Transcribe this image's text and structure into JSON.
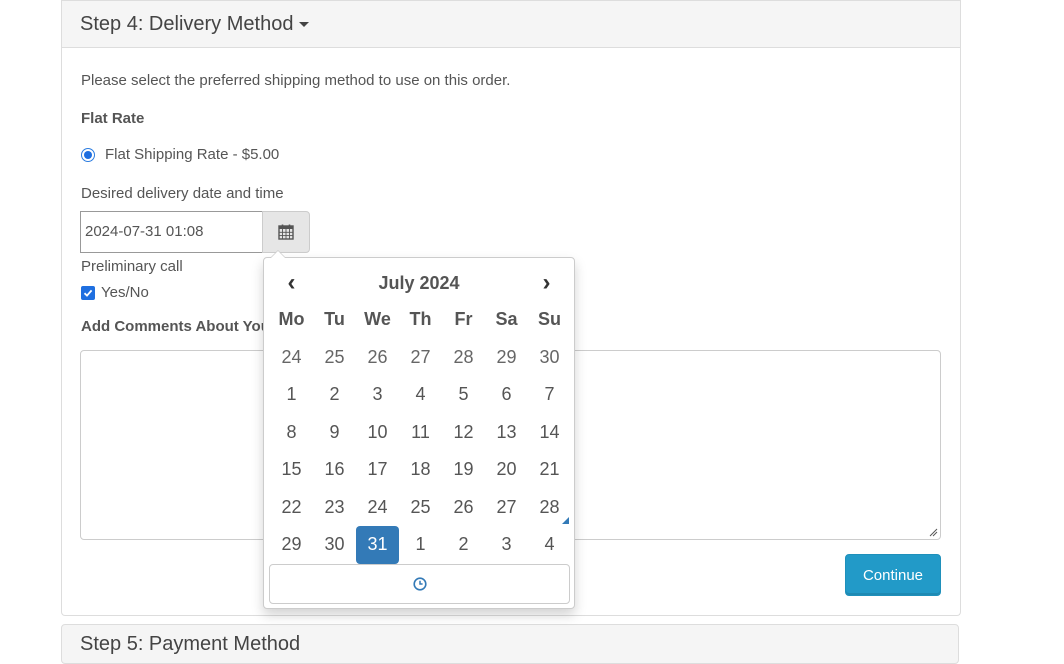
{
  "step4": {
    "title": "Step 4: Delivery Method",
    "intro": "Please select the preferred shipping method to use on this order.",
    "rate_group_title": "Flat Rate",
    "rate_option_label": "Flat Shipping Rate - $5.00",
    "rate_selected": true,
    "date_label": "Desired delivery date and time",
    "date_value": "2024-07-31 01:08",
    "preliminary_call_label": "Preliminary call",
    "preliminary_call_option": "Yes/No",
    "preliminary_call_checked": true,
    "comments_label": "Add Comments About Your Order",
    "comments_value": "",
    "continue_label": "Continue"
  },
  "step5": {
    "title": "Step 5: Payment Method"
  },
  "datepicker": {
    "prev": "‹",
    "next": "›",
    "month_title": "July 2024",
    "weekdays": [
      "Mo",
      "Tu",
      "We",
      "Th",
      "Fr",
      "Sa",
      "Su"
    ],
    "weeks": [
      [
        "24",
        "25",
        "26",
        "27",
        "28",
        "29",
        "30"
      ],
      [
        "1",
        "2",
        "3",
        "4",
        "5",
        "6",
        "7"
      ],
      [
        "8",
        "9",
        "10",
        "11",
        "12",
        "13",
        "14"
      ],
      [
        "15",
        "16",
        "17",
        "18",
        "19",
        "20",
        "21"
      ],
      [
        "22",
        "23",
        "24",
        "25",
        "26",
        "27",
        "28"
      ],
      [
        "29",
        "30",
        "31",
        "1",
        "2",
        "3",
        "4"
      ]
    ],
    "selected_day": "31",
    "today_day": "28"
  },
  "icons": {
    "calendar": "calendar-icon",
    "time": "clock-icon",
    "caret": "caret-down-icon"
  },
  "colors": {
    "accent": "#337ab7",
    "button": "#229ac8",
    "panel_heading_bg": "#f5f5f5"
  }
}
